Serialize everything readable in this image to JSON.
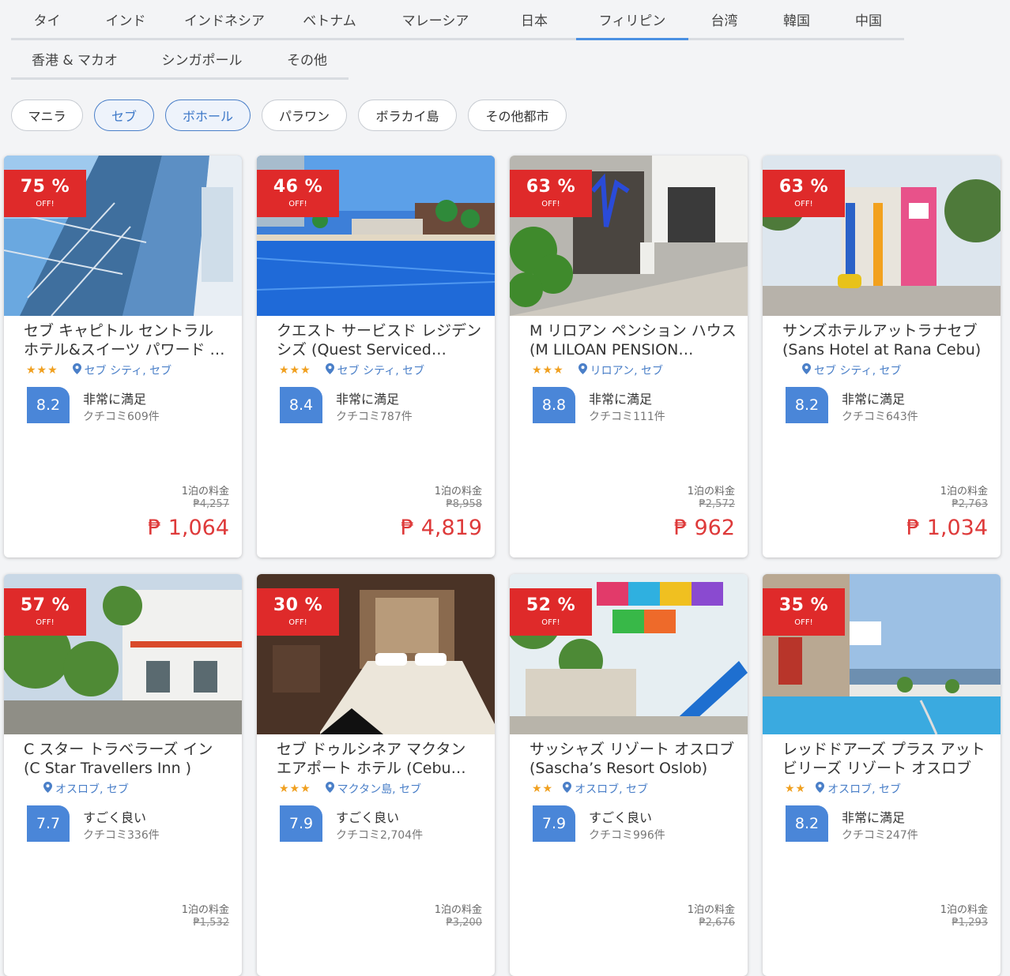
{
  "country_tabs": [
    {
      "label": "タイ"
    },
    {
      "label": "インド"
    },
    {
      "label": "インドネシア"
    },
    {
      "label": "ベトナム"
    },
    {
      "label": "マレーシア"
    },
    {
      "label": "日本"
    },
    {
      "label": "フィリピン",
      "active": true
    },
    {
      "label": "台湾"
    },
    {
      "label": "韓国"
    },
    {
      "label": "中国"
    },
    {
      "label": "香港 & マカオ"
    },
    {
      "label": "シンガポール"
    },
    {
      "label": "その他"
    }
  ],
  "city_chips": [
    {
      "label": "マニラ"
    },
    {
      "label": "セブ",
      "selected": true
    },
    {
      "label": "ボホール",
      "selected": true
    },
    {
      "label": "パラワン"
    },
    {
      "label": "ボラカイ島"
    },
    {
      "label": "その他都市"
    }
  ],
  "colors": {
    "accent": "#4a90e2",
    "discount_red": "#df2a2a",
    "price_red": "#de3a3a",
    "score_blue": "#4a86d8",
    "star": "#f0a020",
    "link_blue": "#4a7fc8"
  },
  "hotels": [
    {
      "discount": "75 %",
      "off": "OFF!",
      "name": "セブ キャピトル セントラル ホテル&スイーツ パワード バイ ASTON",
      "stars": "★★★",
      "location": "セブ シティ, セブ",
      "score": "8.2",
      "rating_text": "非常に満足",
      "reviews": "クチコミ609件",
      "price_label": "1泊の料金",
      "old_price": "₱4,257",
      "price": "₱ 1,064",
      "photo": "glass-building"
    },
    {
      "discount": "46 %",
      "off": "OFF!",
      "name": "クエスト サービスド レジデンシズ (Quest Serviced Residences)",
      "stars": "★★★",
      "location": "セブ シティ, セブ",
      "score": "8.4",
      "rating_text": "非常に満足",
      "reviews": "クチコミ787件",
      "price_label": "1泊の料金",
      "old_price": "₱8,958",
      "price": "₱ 4,819",
      "photo": "pool"
    },
    {
      "discount": "63 %",
      "off": "OFF!",
      "name": "M リロアン ペンション ハウス (M LILOAN PENSION HOUSE)",
      "stars": "★★★",
      "location": "リロアン, セブ",
      "score": "8.8",
      "rating_text": "非常に満足",
      "reviews": "クチコミ111件",
      "price_label": "1泊の料金",
      "old_price": "₱2,572",
      "price": "₱ 962",
      "photo": "sign"
    },
    {
      "discount": "63 %",
      "off": "OFF!",
      "name": "サンズホテルアットラナセブ (Sans Hotel at Rana Cebu)",
      "stars": "",
      "location": "セブ シティ, セブ",
      "score": "8.2",
      "rating_text": "非常に満足",
      "reviews": "クチコミ643件",
      "price_label": "1泊の料金",
      "old_price": "₱2,763",
      "price": "₱ 1,034",
      "photo": "colorful-building"
    },
    {
      "discount": "57 %",
      "off": "OFF!",
      "name": "C スター トラベラーズ イン (C Star Travellers Inn )",
      "stars": "",
      "location": "オスロブ, セブ",
      "score": "7.7",
      "rating_text": "すごく良い",
      "reviews": "クチコミ336件",
      "price_label": "1泊の料金",
      "old_price": "₱1,532",
      "price": "",
      "photo": "white-house"
    },
    {
      "discount": "30 %",
      "off": "OFF!",
      "name": "セブ ドゥルシネア マクタン エアポート ホテル (Cebu Dulcinea Mactan Airport Hotel)",
      "stars": "★★★",
      "location": "マクタン島, セブ",
      "score": "7.9",
      "rating_text": "すごく良い",
      "reviews": "クチコミ2,704件",
      "price_label": "1泊の料金",
      "old_price": "₱3,200",
      "price": "",
      "photo": "bedroom"
    },
    {
      "discount": "52 %",
      "off": "OFF!",
      "name": "サッシャズ リゾート オスロブ (Sascha’s Resort Oslob)",
      "stars": "★★",
      "location": "オスロブ, セブ",
      "score": "7.9",
      "rating_text": "すごく良い",
      "reviews": "クチコミ996件",
      "price_label": "1泊の料金",
      "old_price": "₱2,676",
      "price": "",
      "photo": "resort-slide"
    },
    {
      "discount": "35 %",
      "off": "OFF!",
      "name": "レッドドアーズ プラス アット ビリーズ リゾート オスロブ",
      "stars": "★★",
      "location": "オスロブ, セブ",
      "score": "8.2",
      "rating_text": "非常に満足",
      "reviews": "クチコミ247件",
      "price_label": "1泊の料金",
      "old_price": "₱1,293",
      "price": "",
      "photo": "seaside-pool"
    }
  ]
}
